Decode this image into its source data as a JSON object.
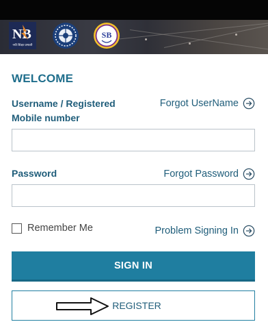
{
  "header": {
    "logos": [
      {
        "name": "nb-logo",
        "text": "NB",
        "caption": "नयी शिक्षा प्रणाली"
      },
      {
        "name": "university-emblem-logo"
      },
      {
        "name": "sb-logo",
        "text": "SB"
      }
    ]
  },
  "login": {
    "welcome": "WELCOME",
    "username_label_line1": "Username / Registered",
    "username_label_line2": "Mobile number",
    "forgot_username": "Forgot UserName",
    "username_value": "",
    "password_label": "Password",
    "forgot_password": "Forgot Password",
    "password_value": "",
    "remember_me": "Remember Me",
    "problem_signing_in": "Problem Signing In",
    "sign_in": "SIGN IN",
    "register": "REGISTER"
  },
  "colors": {
    "accent": "#1f7ea0",
    "link_text": "#1f5d7a",
    "header_bg": "#050505"
  },
  "icons": {
    "link_arrow": "arrow-right-circle-icon",
    "pointer_arrow": "hand-drawn-arrow-icon"
  }
}
